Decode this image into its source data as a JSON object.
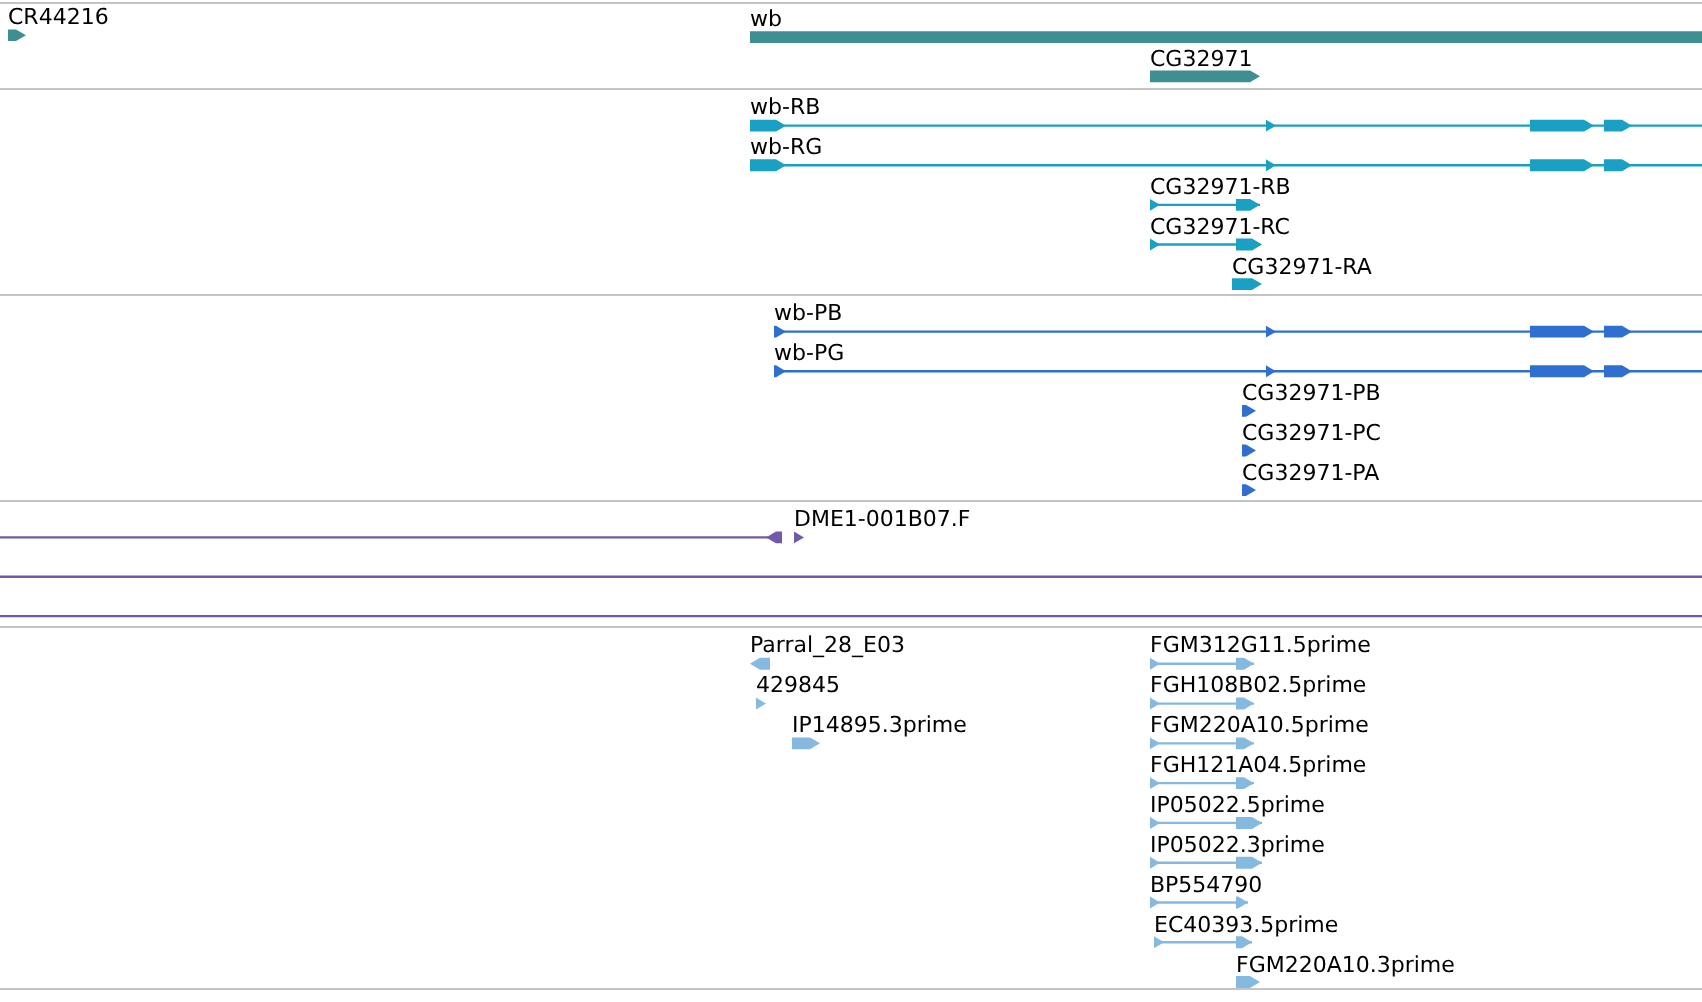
{
  "tracks": [
    {
      "color": "#3f8f92",
      "features": [
        {
          "label": "CR44216"
        },
        {
          "label": "wb"
        },
        {
          "label": "CG32971"
        }
      ]
    },
    {
      "color": "#1aa0c2",
      "features": [
        {
          "label": "wb-RB"
        },
        {
          "label": "wb-RG"
        },
        {
          "label": "CG32971-RB"
        },
        {
          "label": "CG32971-RC"
        },
        {
          "label": "CG32971-RA"
        }
      ]
    },
    {
      "color": "#2f6fd0",
      "features": [
        {
          "label": "wb-PB"
        },
        {
          "label": "wb-PG"
        },
        {
          "label": "CG32971-PB"
        },
        {
          "label": "CG32971-PC"
        },
        {
          "label": "CG32971-PA"
        }
      ]
    },
    {
      "color": "#7258a8",
      "features": [
        {
          "label": "DME1-001B07.F"
        }
      ]
    },
    {
      "color": "#86b9e0",
      "features": [
        {
          "label": "Parral_28_E03"
        },
        {
          "label": "429845"
        },
        {
          "label": "IP14895.3prime"
        },
        {
          "label": "FGM312G11.5prime"
        },
        {
          "label": "FGH108B02.5prime"
        },
        {
          "label": "FGM220A10.5prime"
        },
        {
          "label": "FGH121A04.5prime"
        },
        {
          "label": "IP05022.5prime"
        },
        {
          "label": "IP05022.3prime"
        },
        {
          "label": "BP554790"
        },
        {
          "label": "EC40393.5prime"
        },
        {
          "label": "FGM220A10.3prime"
        }
      ]
    }
  ]
}
